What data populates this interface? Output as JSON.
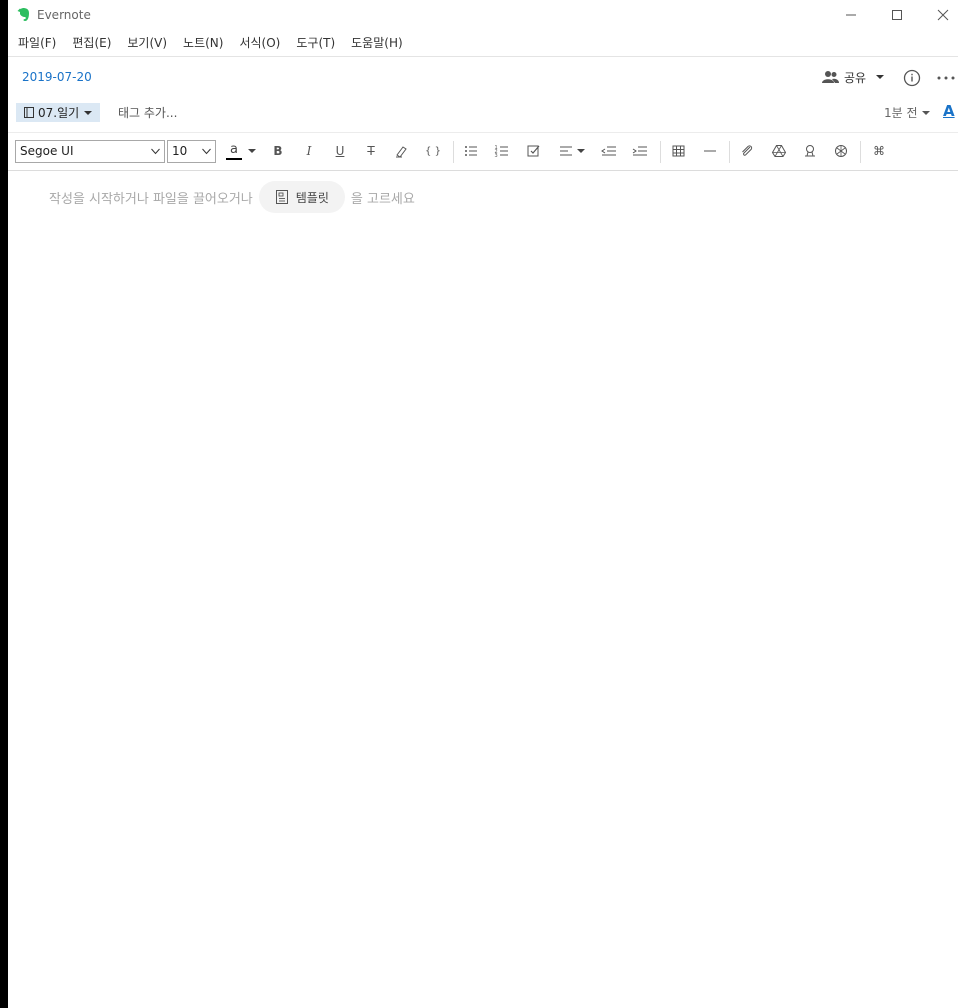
{
  "app": {
    "title": "Evernote"
  },
  "menu": [
    "파일(F)",
    "편집(E)",
    "보기(V)",
    "노트(N)",
    "서식(O)",
    "도구(T)",
    "도움말(H)"
  ],
  "header": {
    "date": "2019-07-20",
    "share_label": "공유"
  },
  "notebook": {
    "name": "07.일기",
    "tag_placeholder": "태그 추가...",
    "updated": "1분 전",
    "font_button": "A"
  },
  "toolbar": {
    "font_family": "Segoe UI",
    "font_size": "10",
    "color_letter": "a",
    "bold": "B",
    "italic": "I",
    "underline": "U",
    "strike": "T",
    "code": "{ }"
  },
  "editor": {
    "placeholder_before": "작성을 시작하거나 파일을 끌어오거나",
    "template_label": "템플릿",
    "placeholder_after": "을 고르세요"
  },
  "colors": {
    "accent": "#1a73c8",
    "notebook_bg": "#dbe8f4",
    "logo": "#2dbe60"
  },
  "icons": [
    "evernote-logo-icon",
    "minimize-icon",
    "maximize-icon",
    "close-icon",
    "share-people-icon",
    "info-icon",
    "more-icon",
    "notebook-icon",
    "bullet-list-icon",
    "numbered-list-icon",
    "checkbox-icon",
    "align-icon",
    "outdent-icon",
    "indent-icon",
    "table-icon",
    "horizontal-rule-icon",
    "attachment-icon",
    "google-drive-icon",
    "record-audio-icon",
    "sketch-icon",
    "command-icon",
    "template-icon"
  ]
}
